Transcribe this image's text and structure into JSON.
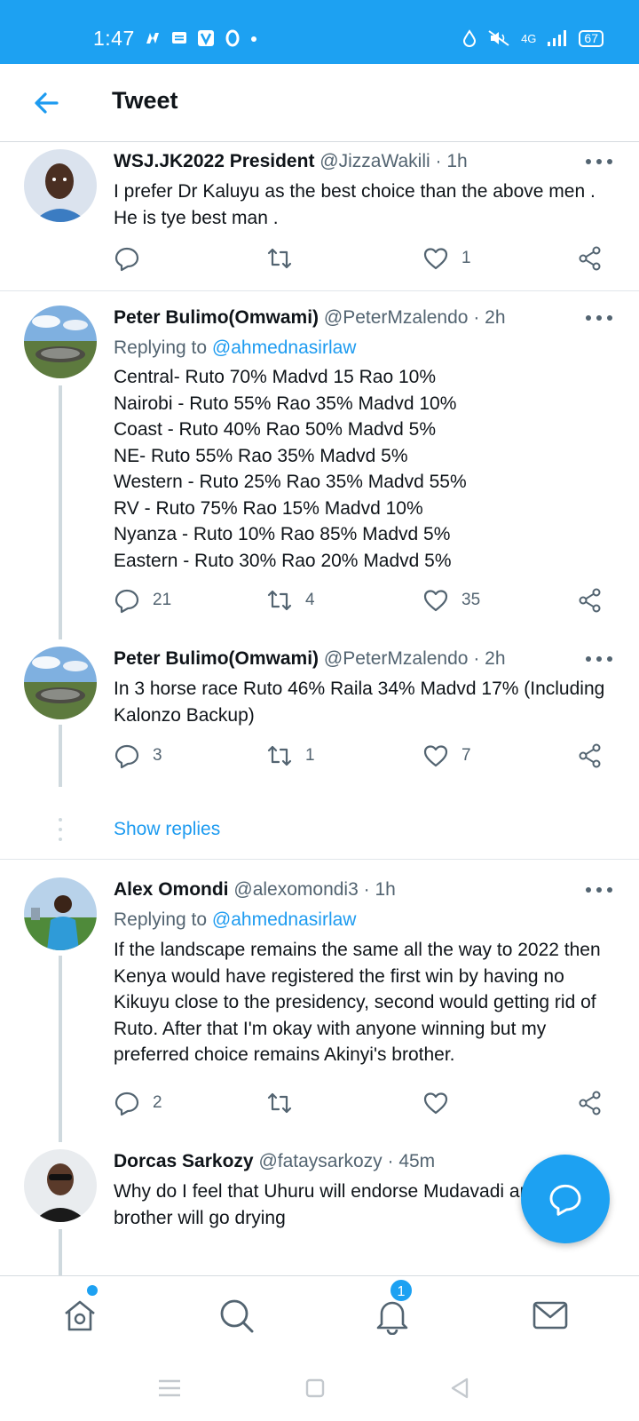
{
  "status_bar": {
    "time": "1:47",
    "network": "4G",
    "battery": "67",
    "accent": "#1da1f2"
  },
  "header": {
    "title": "Tweet"
  },
  "tweets": [
    {
      "name": "WSJ.JK2022 President",
      "handle": "@JizzaWakili",
      "time": "1h",
      "reply_prefix": "",
      "reply_mention": "",
      "text": "I prefer Dr Kaluyu as the best choice  than the above men .   He is tye best man .",
      "replies": "",
      "retweets": "",
      "likes": "1"
    },
    {
      "name": "Peter Bulimo(Omwami)",
      "handle": "@PeterMzalendo",
      "time": "2h",
      "reply_prefix": "Replying to",
      "reply_mention": "@ahmednasirlaw",
      "lines": [
        "Central- Ruto 70% Madvd 15 Rao 10%",
        "Nairobi - Ruto 55% Rao 35% Madvd 10%",
        "Coast - Ruto 40% Rao 50% Madvd 5%",
        "NE- Ruto 55% Rao 35% Madvd 5%",
        "Western - Ruto 25% Rao 35% Madvd 55%",
        "RV - Ruto 75% Rao 15% Madvd 10%",
        "Nyanza - Ruto 10% Rao 85% Madvd 5%",
        "Eastern - Ruto 30% Rao 20% Madvd 5%"
      ],
      "replies": "21",
      "retweets": "4",
      "likes": "35"
    },
    {
      "name": "Peter Bulimo(Omwami)",
      "handle": "@PeterMzalendo",
      "time": "2h",
      "text": "In 3 horse race Ruto 46% Raila 34% Madvd 17% (Including Kalonzo Backup)",
      "replies": "3",
      "retweets": "1",
      "likes": "7"
    },
    {
      "name": "Alex Omondi",
      "handle": "@alexomondi3",
      "time": "1h",
      "reply_prefix": "Replying to",
      "reply_mention": "@ahmednasirlaw",
      "text": "If the landscape remains the same all the way to 2022 then Kenya would have registered the first win by having no Kikuyu close to the presidency, second would getting rid of Ruto. After that I'm okay with anyone winning but my preferred choice remains Akinyi's brother.",
      "replies": "2",
      "retweets": "",
      "likes": ""
    },
    {
      "name": "Dorcas Sarkozy",
      "handle": "@fataysarkozy",
      "time": "45m",
      "text": "Why do I feel that Uhuru will endorse Mudavadi and Akinyi's brother will go drying"
    }
  ],
  "show_replies": "Show replies",
  "bottom_nav": {
    "notifications_count": "1"
  },
  "separator": "·"
}
